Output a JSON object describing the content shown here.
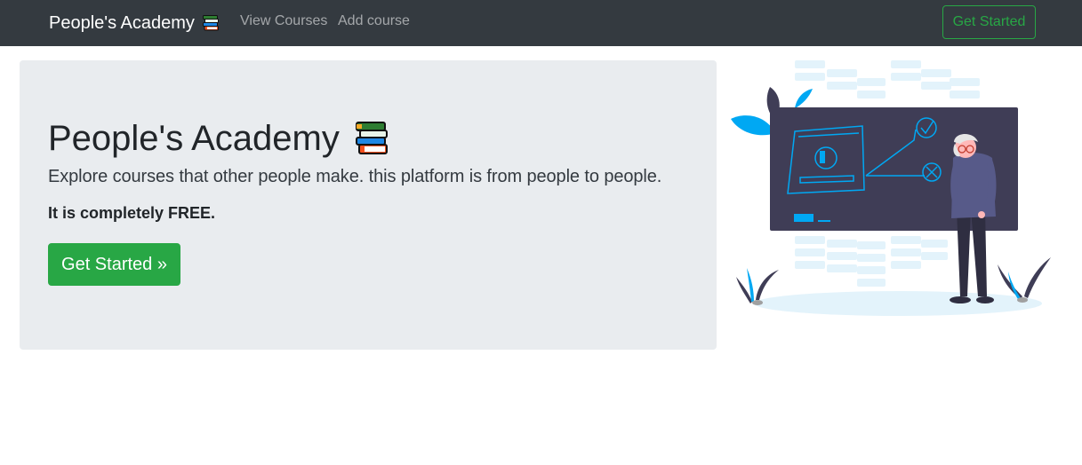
{
  "navbar": {
    "brand": "People's Academy",
    "brand_icon": "books-icon",
    "links": [
      "View Courses",
      "Add course"
    ],
    "cta_label": "Get Started"
  },
  "hero": {
    "title": "People's Academy",
    "title_icon": "books-icon",
    "lead": "Explore courses that other people make. this platform is from people to people.",
    "emphasis": "It is completely FREE.",
    "cta_label": "Get Started »"
  },
  "colors": {
    "navbar_bg": "#343a40",
    "accent_green": "#28a745",
    "jumbotron_bg": "#e9ecef",
    "illustration_board": "#3f3d56",
    "illustration_accent": "#00a8f3"
  }
}
